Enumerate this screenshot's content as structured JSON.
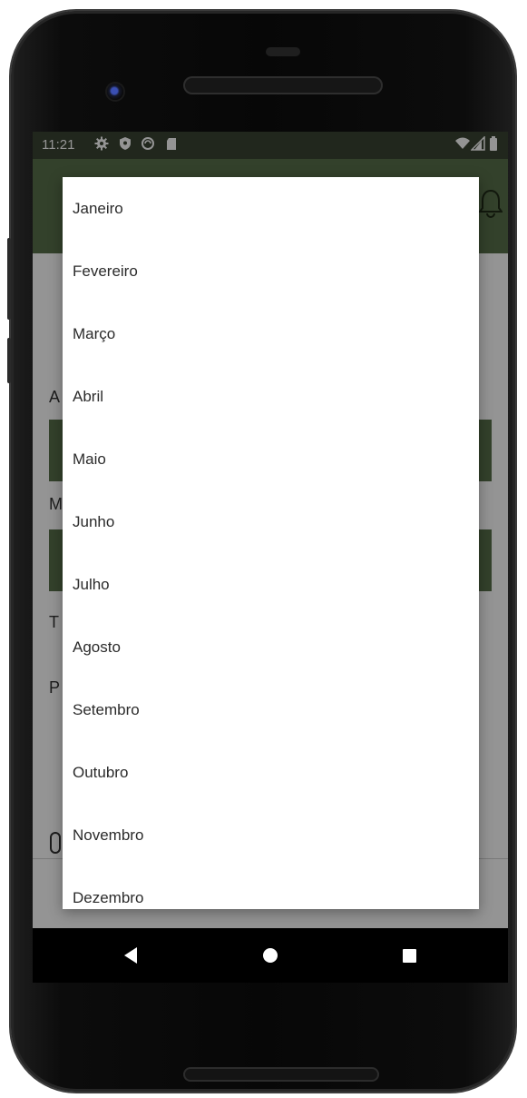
{
  "status_bar": {
    "time": "11:21",
    "left_icons": [
      "settings-icon",
      "shield-icon",
      "sync-icon",
      "sd-card-icon"
    ],
    "right_icons": [
      "wifi-icon",
      "signal-icon",
      "battery-icon"
    ]
  },
  "background": {
    "labels": [
      "A",
      "M",
      "T",
      "P"
    ],
    "colors": {
      "app_bar": "#58704a",
      "status_bar": "#3a4432"
    }
  },
  "dropdown": {
    "items": [
      "Janeiro",
      "Fevereiro",
      "Março",
      "Abril",
      "Maio",
      "Junho",
      "Julho",
      "Agosto",
      "Setembro",
      "Outubro",
      "Novembro",
      "Dezembro"
    ]
  },
  "nav_bar": {
    "buttons": [
      "back-icon",
      "home-icon",
      "recents-icon"
    ]
  }
}
